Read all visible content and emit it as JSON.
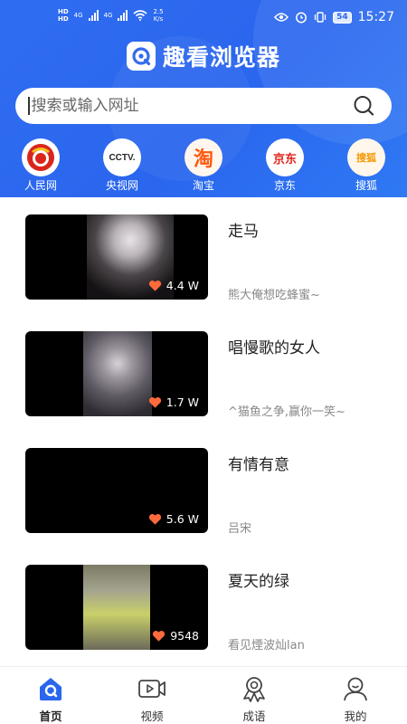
{
  "status_bar": {
    "hd_label": "HD",
    "net_left": "4G",
    "net_right": "4G",
    "speed_value": "2.5",
    "speed_unit": "K/s",
    "battery": "54",
    "time": "15:27"
  },
  "header": {
    "app_title": "趣看浏览器",
    "accent_color": "#2a66ee"
  },
  "search": {
    "placeholder": "搜索或输入网址"
  },
  "shortcuts": [
    {
      "label": "人民网",
      "icon": "people-daily-icon"
    },
    {
      "label": "央视网",
      "icon": "cctv-icon",
      "logo_text": "CCTV."
    },
    {
      "label": "淘宝",
      "icon": "taobao-icon",
      "logo_text": "淘"
    },
    {
      "label": "京东",
      "icon": "jd-icon",
      "logo_text": "京东"
    },
    {
      "label": "搜狐",
      "icon": "sohu-icon",
      "logo_text": "搜狐"
    }
  ],
  "videos": [
    {
      "title": "走马",
      "author": "熊大俺想吃蜂蜜~",
      "likes": "4.4 W"
    },
    {
      "title": "唱慢歌的女人",
      "author": "^猫鱼之争,赢你一笑~",
      "likes": "1.7 W"
    },
    {
      "title": "有情有意",
      "author": "吕宋",
      "likes": "5.6 W"
    },
    {
      "title": "夏天的绿",
      "author": "看见煙波灿lan",
      "likes": "9548"
    }
  ],
  "bottom_nav": [
    {
      "label": "首页",
      "icon": "home-icon",
      "active": true
    },
    {
      "label": "视频",
      "icon": "video-icon"
    },
    {
      "label": "成语",
      "icon": "idiom-icon"
    },
    {
      "label": "我的",
      "icon": "profile-icon"
    }
  ]
}
